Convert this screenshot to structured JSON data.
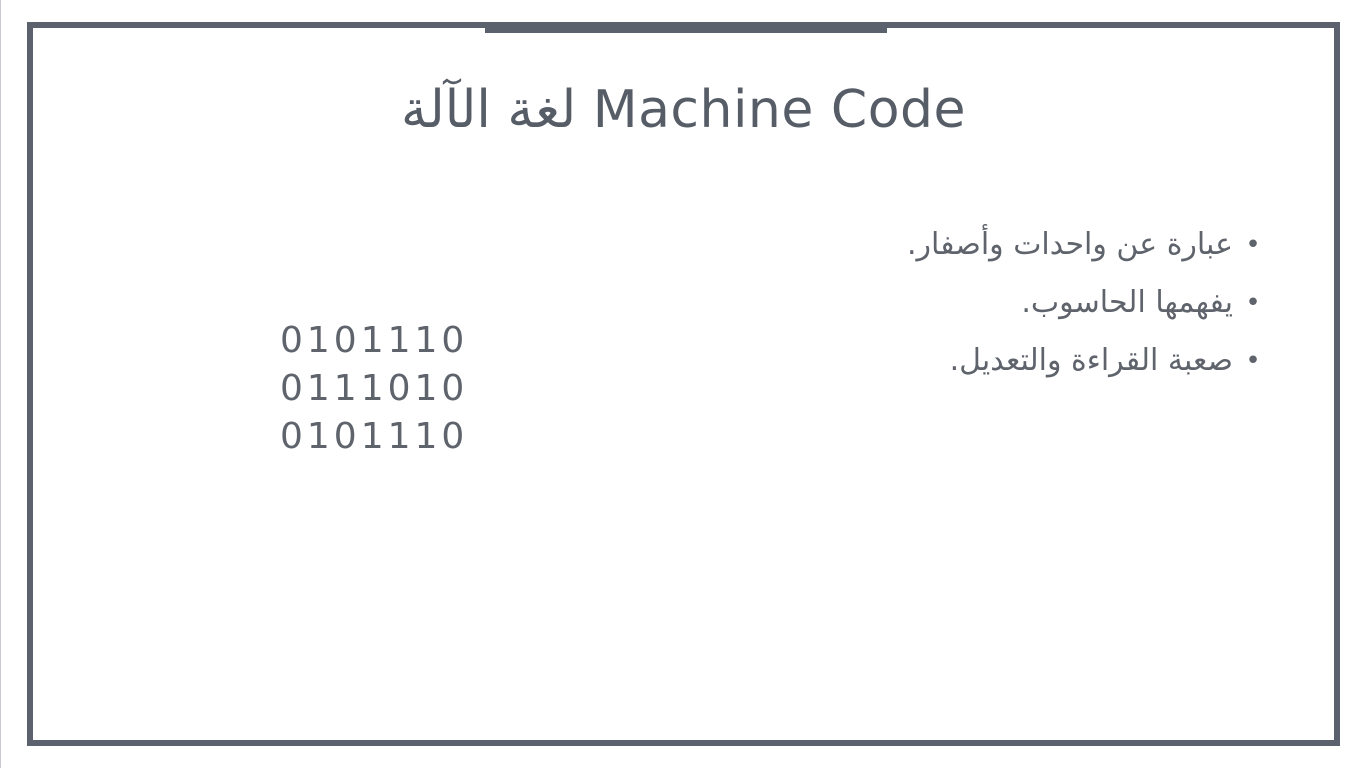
{
  "slide": {
    "title": "لغة الآلة Machine Code",
    "bullets": [
      {
        "text": "عبارة عن واحدات وأصفار."
      },
      {
        "text": "يفهمها الحاسوب."
      },
      {
        "text": "صعبة القراءة والتعديل."
      }
    ],
    "bullet_symbol": "•",
    "binary_rows": [
      "0101110",
      "0111010",
      "0101110"
    ]
  }
}
